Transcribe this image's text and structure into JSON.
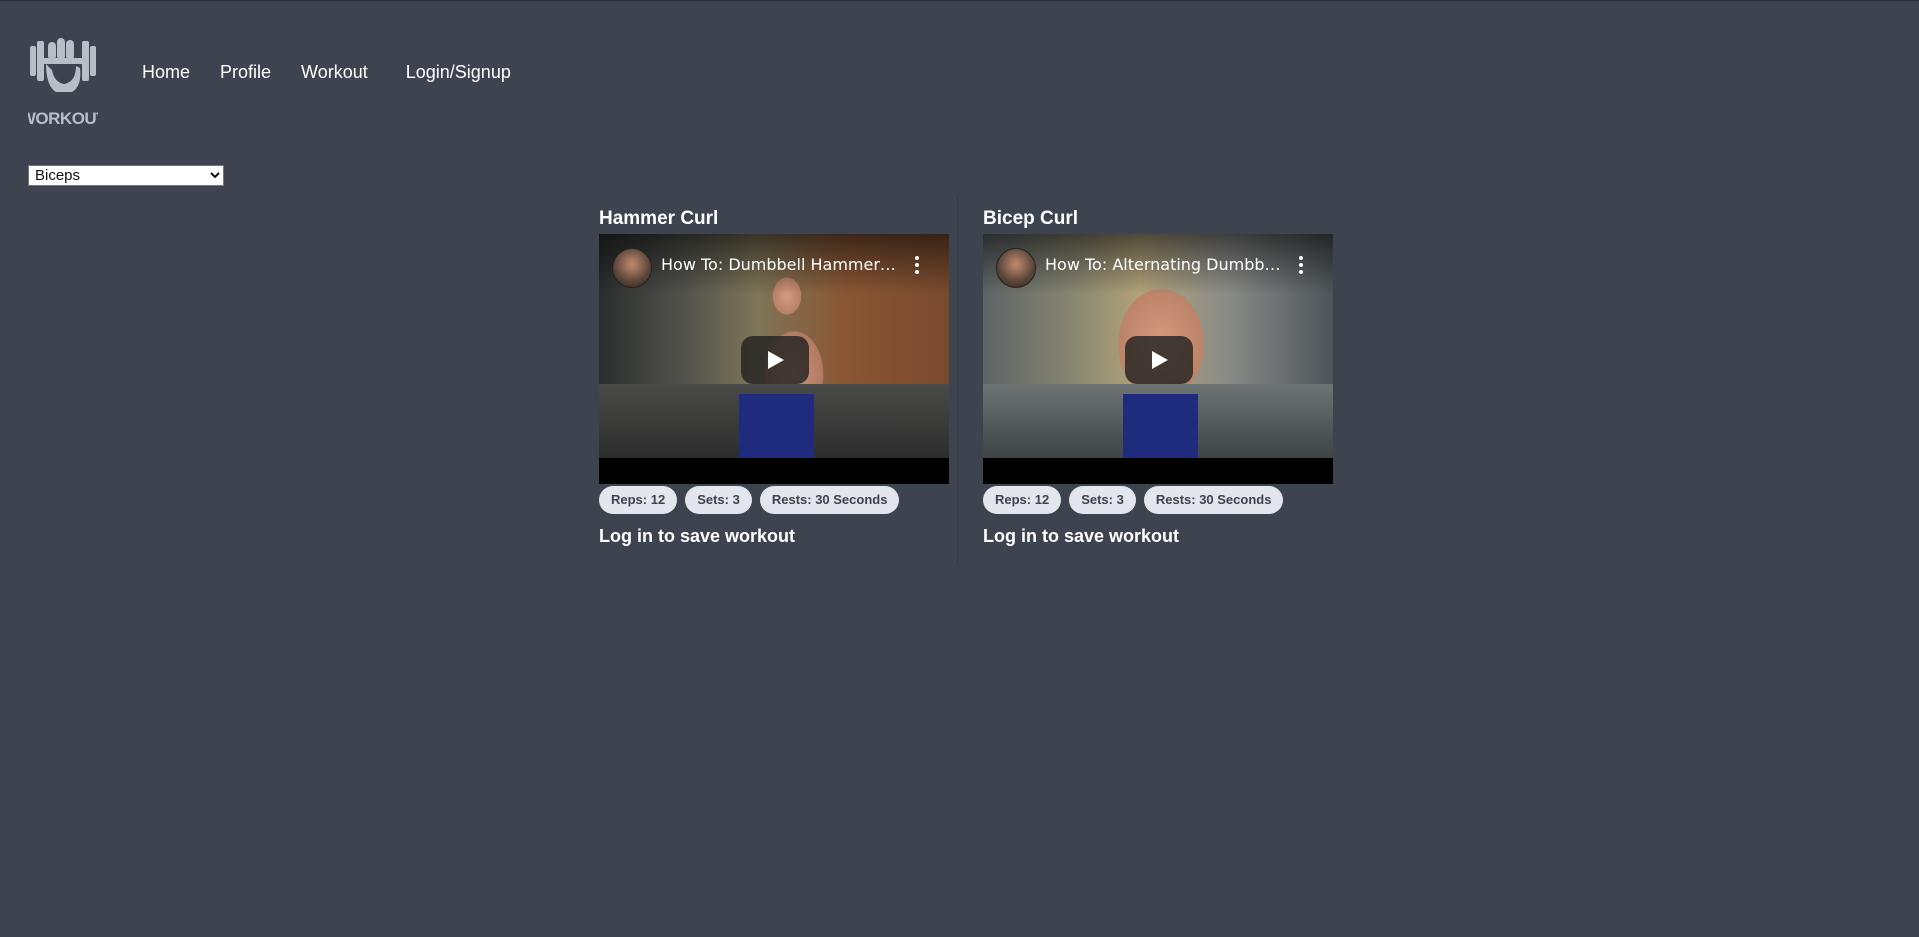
{
  "logo": {
    "text": "WORKOUT",
    "icon": "dumbbell-fist-logo"
  },
  "nav": {
    "home": "Home",
    "profile": "Profile",
    "workout": "Workout",
    "login": "Login/Signup"
  },
  "muscle_select": {
    "selected": "Biceps"
  },
  "exercises": [
    {
      "name": "Hammer Curl",
      "video_title": "How To: Dumbbell Hammer Curl",
      "reps": "Reps: 12",
      "sets": "Sets: 3",
      "rests": "Rests: 30 Seconds",
      "save_note": "Log in to save workout"
    },
    {
      "name": "Bicep Curl",
      "video_title": "How To: Alternating Dumbbell Curl",
      "reps": "Reps: 12",
      "sets": "Sets: 3",
      "rests": "Rests: 30 Seconds",
      "save_note": "Log in to save workout"
    }
  ],
  "colors": {
    "background": "#3d4450",
    "pill_background": "#e3e6ec",
    "pill_text": "#3d4450",
    "text": "#ffffff"
  }
}
